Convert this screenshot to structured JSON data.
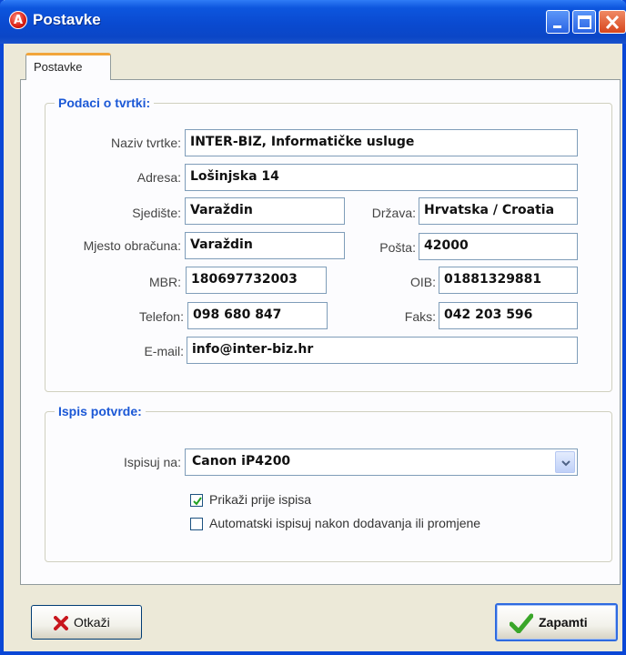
{
  "window": {
    "title": "Postavke",
    "icon": "app-logo-icon"
  },
  "tabs": [
    {
      "label": "Postavke",
      "active": true
    }
  ],
  "company_group": {
    "title": "Podaci o tvrtki:",
    "fields": {
      "naziv": {
        "label": "Naziv tvrtke:",
        "value": "INTER-BIZ, Informatičke usluge"
      },
      "adresa": {
        "label": "Adresa:",
        "value": "Lošinjska 14"
      },
      "sjediste": {
        "label": "Sjedište:",
        "value": "Varaždin"
      },
      "drzava": {
        "label": "Država:",
        "value": "Hrvatska / Croatia"
      },
      "mjesto": {
        "label": "Mjesto obračuna:",
        "value": "Varaždin"
      },
      "posta": {
        "label": "Pošta:",
        "value": "42000"
      },
      "mbr": {
        "label": "MBR:",
        "value": "180697732003"
      },
      "oib": {
        "label": "OIB:",
        "value": "01881329881"
      },
      "telefon": {
        "label": "Telefon:",
        "value": "098 680 847"
      },
      "faks": {
        "label": "Faks:",
        "value": "042 203 596"
      },
      "email": {
        "label": "E-mail:",
        "value": "info@inter-biz.hr"
      }
    }
  },
  "print_group": {
    "title": "Ispis potvrde:",
    "printer_label": "Ispisuj na:",
    "printer_value": "Canon iP4200",
    "options": [
      {
        "label": "Prikaži prije ispisa",
        "checked": true
      },
      {
        "label": "Automatski ispisuj nakon dodavanja ili promjene",
        "checked": false
      }
    ]
  },
  "buttons": {
    "cancel": "Otkaži",
    "save": "Zapamti"
  },
  "colors": {
    "titlebar": "#0a4ad0",
    "group_title": "#1b58d6",
    "cancel_icon": "#c8161d",
    "save_icon": "#3aa629"
  }
}
